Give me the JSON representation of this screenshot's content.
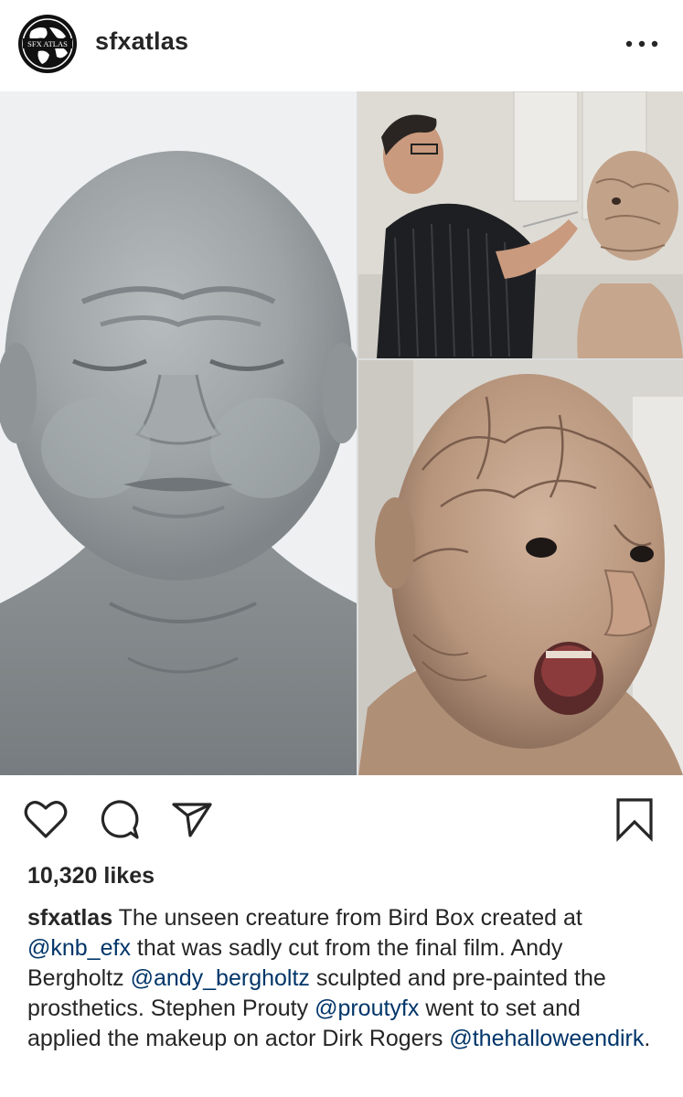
{
  "post": {
    "username": "sfxatlas",
    "avatar_text": "SFX ATLAS",
    "likes": "10,320 likes",
    "caption": {
      "author": "sfxatlas",
      "t1": " The unseen creature from Bird Box created at ",
      "m1": "@knb_efx",
      "t2": " that was sadly cut from the final film. Andy Bergholtz ",
      "m2": "@andy_bergholtz",
      "t3": " sculpted and pre-painted the prosthetics. Stephen Prouty ",
      "m3": "@proutyfx",
      "t4": " went to set and applied the makeup on actor Dirk Rogers ",
      "m4": "@thehalloweendirk",
      "t5": "."
    }
  },
  "icons": {
    "more": "more-options-icon",
    "like": "heart-icon",
    "comment": "comment-icon",
    "share": "share-icon",
    "save": "bookmark-icon"
  },
  "colors": {
    "text": "#262626",
    "mention": "#003569",
    "background": "#ffffff"
  }
}
